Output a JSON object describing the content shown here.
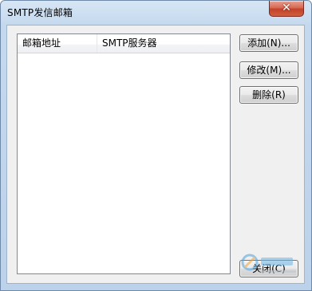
{
  "window": {
    "title": "SMTP发信邮箱",
    "close_glyph": "✕"
  },
  "listview": {
    "columns": [
      "邮箱地址",
      "SMTP服务器"
    ],
    "rows": []
  },
  "buttons": {
    "add": "添加(N)...",
    "edit": "修改(M)...",
    "delete": "删除(R)",
    "close": "关闭(C)"
  },
  "icons": {
    "window_close": "close-icon",
    "watermark": "site-watermark-logo"
  },
  "colors": {
    "title_bar": "#c5d9ee",
    "client_bg": "#f0f0f0",
    "close_button": "#c2412a"
  }
}
